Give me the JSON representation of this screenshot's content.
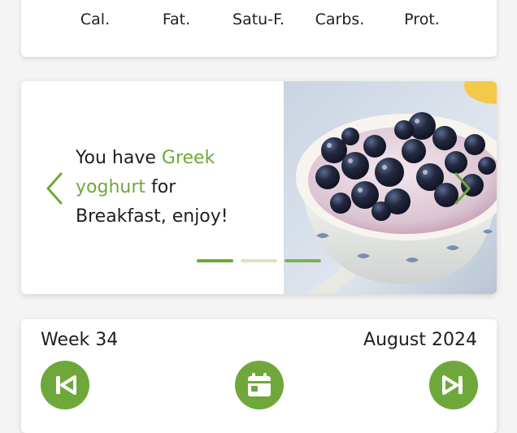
{
  "nutrients": [
    {
      "label": "Cal.",
      "ring_color": "#6c6c6c"
    },
    {
      "label": "Fat.",
      "ring_color": "#e7d264"
    },
    {
      "label": "Satu-F.",
      "ring_color": "#e69a4f"
    },
    {
      "label": "Carbs.",
      "ring_color": "#2f6e55"
    },
    {
      "label": "Prot.",
      "ring_color": "#c8524f"
    }
  ],
  "meal": {
    "prefix": "You have ",
    "food": "Greek yoghurt",
    "middle": " for ",
    "meal_name": "Breakfast",
    "suffix": ", enjoy!",
    "image": "greek-yoghurt-with-blueberries",
    "slide_count": 3,
    "active_slide": 1
  },
  "week": {
    "week_label": "Week 34",
    "month_label": "August 2024",
    "prev_icon": "skip-previous-icon",
    "calendar_icon": "calendar-icon",
    "next_icon": "skip-next-icon"
  },
  "colors": {
    "accent": "#6fa83a",
    "dot_active": "#6fa83a",
    "dot_inactive": "#d7e4c6"
  }
}
